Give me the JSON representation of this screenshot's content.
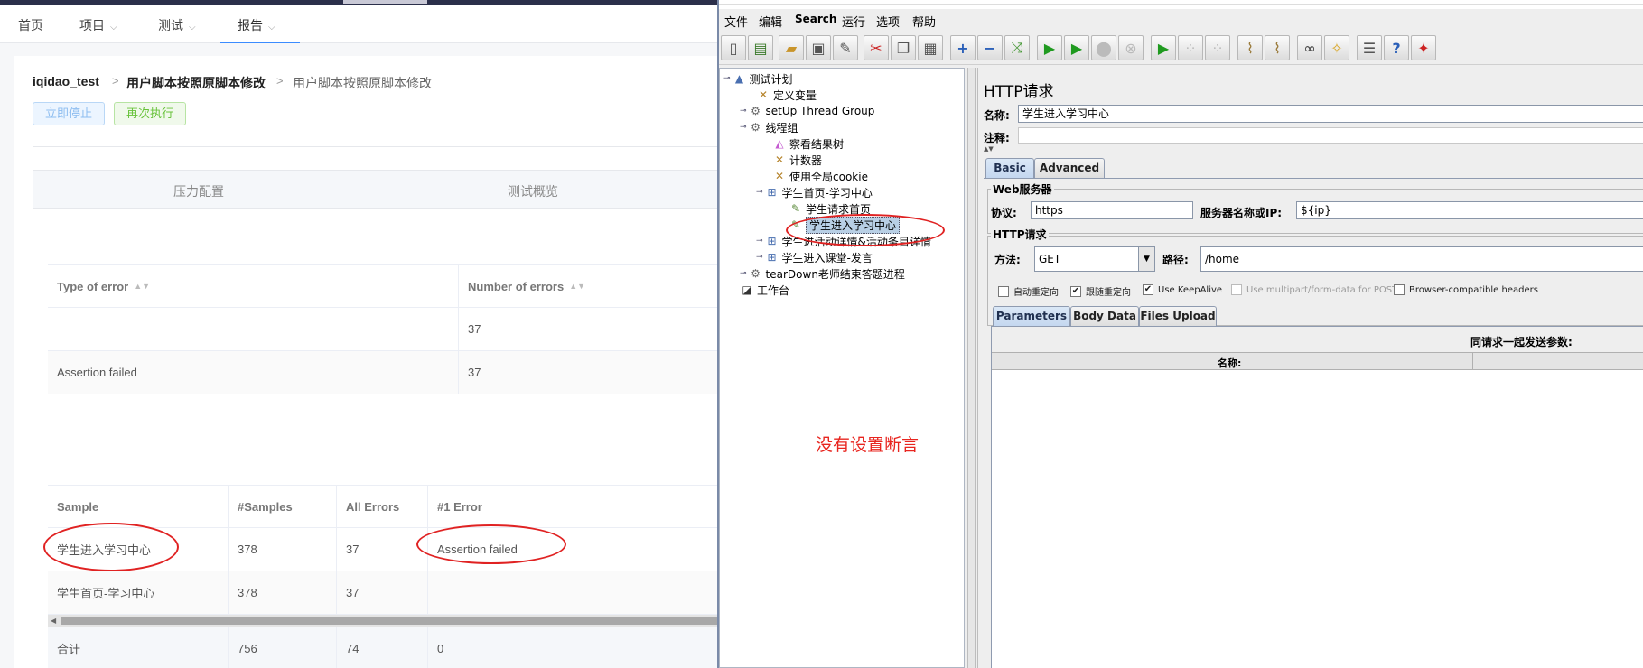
{
  "web": {
    "nav": [
      {
        "label": "首页",
        "dropdown": false
      },
      {
        "label": "项目",
        "dropdown": true
      },
      {
        "label": "测试",
        "dropdown": true
      },
      {
        "label": "报告",
        "dropdown": true,
        "active": true
      }
    ],
    "breadcrumb": [
      "iqidao_test",
      "用户脚本按照原脚本修改",
      "用户脚本按照原脚本修改"
    ],
    "breadcrumb_sep": ">",
    "buttons": {
      "stop": "立即停止",
      "rerun": "再次执行"
    },
    "tabs": [
      "压力配置",
      "测试概览"
    ],
    "errors_table": {
      "headers": [
        "Type of error",
        "Number of errors"
      ],
      "rows": [
        [
          "",
          "37"
        ],
        [
          "Assertion failed",
          "37"
        ]
      ]
    },
    "samples_table": {
      "headers": [
        "Sample",
        "#Samples",
        "All Errors",
        "#1 Error"
      ],
      "rows": [
        [
          "学生进入学习中心",
          "378",
          "37",
          "Assertion failed"
        ],
        [
          "学生首页-学习中心",
          "378",
          "37",
          ""
        ]
      ],
      "total": [
        "合计",
        "756",
        "74",
        "0"
      ]
    }
  },
  "jmeter": {
    "menu": [
      "文件",
      "编辑",
      "Search",
      "运行",
      "选项",
      "帮助"
    ],
    "toolbar_icons": [
      "new-icon",
      "templates-icon",
      "open-icon",
      "save-icon",
      "save-as-icon",
      "cut-icon",
      "copy-icon",
      "paste-icon",
      "expand-icon",
      "collapse-icon",
      "toggle-icon",
      "start-icon",
      "start-no-pause-icon",
      "stop-icon",
      "shutdown-icon",
      "remote-start-icon",
      "remote-stop-icon",
      "remote-shutdown-icon",
      "clear-icon",
      "clear-all-icon",
      "search-icon",
      "reset-search-icon",
      "function-helper-icon",
      "help-icon",
      "log-icon"
    ],
    "tree": [
      {
        "label": "测试计划",
        "icon": "test-plan-icon"
      },
      {
        "label": "定义变量",
        "icon": "config-icon"
      },
      {
        "label": "setUp Thread Group",
        "icon": "thread-group-icon"
      },
      {
        "label": "线程组",
        "icon": "thread-group-icon"
      },
      {
        "label": "察看结果树",
        "icon": "listener-icon"
      },
      {
        "label": "计数器",
        "icon": "config-icon"
      },
      {
        "label": "使用全局cookie",
        "icon": "config-icon"
      },
      {
        "label": "学生首页-学习中心",
        "icon": "controller-icon"
      },
      {
        "label": "学生请求首页",
        "icon": "sampler-icon"
      },
      {
        "label": "学生进入学习中心",
        "icon": "sampler-icon",
        "selected": true
      },
      {
        "label": "学生进活动详情&活动条目详情",
        "icon": "controller-icon"
      },
      {
        "label": "学生进入课堂-发言",
        "icon": "controller-icon"
      },
      {
        "label": "tearDown老师结束答题进程",
        "icon": "thread-group-icon"
      },
      {
        "label": "工作台",
        "icon": "workbench-icon"
      }
    ],
    "panel": {
      "title": "HTTP请求",
      "name_label": "名称:",
      "name_value": "学生进入学习中心",
      "comment_label": "注释:",
      "tabs": [
        "Basic",
        "Advanced"
      ],
      "web_server_title": "Web服务器",
      "protocol_label": "协议:",
      "protocol_value": "https",
      "server_label": "服务器名称或IP:",
      "server_value": "${ip}",
      "http_request_title": "HTTP请求",
      "method_label": "方法:",
      "method_value": "GET",
      "path_label": "路径:",
      "path_value": "/home",
      "checkboxes": [
        {
          "label": "自动重定向",
          "checked": false,
          "disabled": false
        },
        {
          "label": "跟随重定向",
          "checked": true,
          "disabled": false
        },
        {
          "label": "Use KeepAlive",
          "checked": true,
          "disabled": false
        },
        {
          "label": "Use multipart/form-data for POST",
          "checked": false,
          "disabled": true
        },
        {
          "label": "Browser-compatible headers",
          "checked": false,
          "disabled": false
        }
      ],
      "param_tabs": [
        "Parameters",
        "Body Data",
        "Files Upload"
      ],
      "params_caption": "同请求一起发送参数:",
      "params_col": "名称:"
    }
  },
  "annotation": "没有设置断言",
  "colors": {
    "annotation": "#e8251f",
    "accent": "#3b8cff"
  }
}
